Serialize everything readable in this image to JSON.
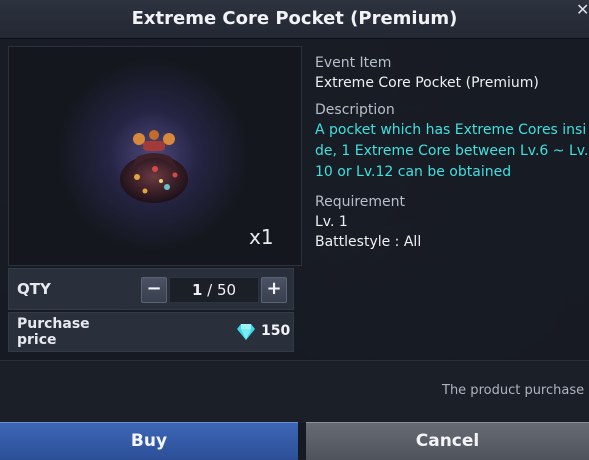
{
  "dialog": {
    "title": "Extreme Core Pocket (Premium)",
    "close_icon": "close-icon"
  },
  "item": {
    "icon": "pocket-icon",
    "quantity_badge": "x1"
  },
  "quantity": {
    "label": "QTY",
    "current": "1",
    "separator": " / ",
    "max": "50",
    "minus_label": "−",
    "plus_label": "+"
  },
  "price": {
    "label": "Purchase price",
    "currency_icon": "diamond-icon",
    "amount": "150",
    "accent_color": "#3fd8ea"
  },
  "info": {
    "event_label": "Event Item",
    "event_value": "Extreme Core Pocket (Premium)",
    "description_label": "Description",
    "description_text": "A pocket which has Extreme Cores inside, 1 Extreme Core between Lv.6 ~ Lv.10 or Lv.12 can be obtained",
    "description_color": "#3fe0df",
    "requirement_label": "Requirement",
    "requirement_level": "Lv. 1",
    "requirement_battlestyle": "Battlestyle : All"
  },
  "notice": {
    "text": "The product purchase"
  },
  "actions": {
    "buy_label": "Buy",
    "cancel_label": "Cancel",
    "buy_color": "#3d66b7",
    "cancel_color": "#5d626b"
  }
}
